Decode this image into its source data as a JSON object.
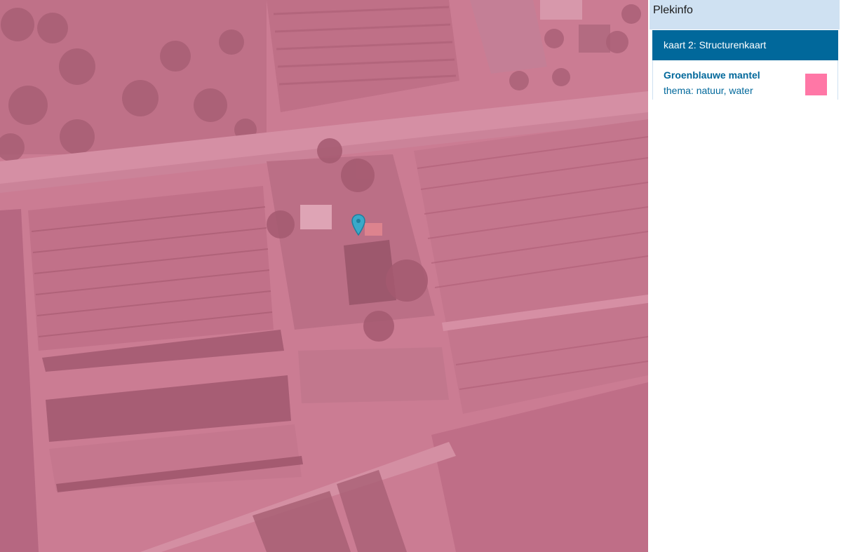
{
  "panel": {
    "title": "Plekinfo",
    "tab_label": "kaart 2: Structurenkaart",
    "item": {
      "name": "Groenblauwe mantel",
      "theme": "thema: natuur, water",
      "swatch_color": "#ff77a6"
    }
  },
  "map": {
    "overlay_color": "#d4708e",
    "marker_color": "#3aa9c9"
  }
}
